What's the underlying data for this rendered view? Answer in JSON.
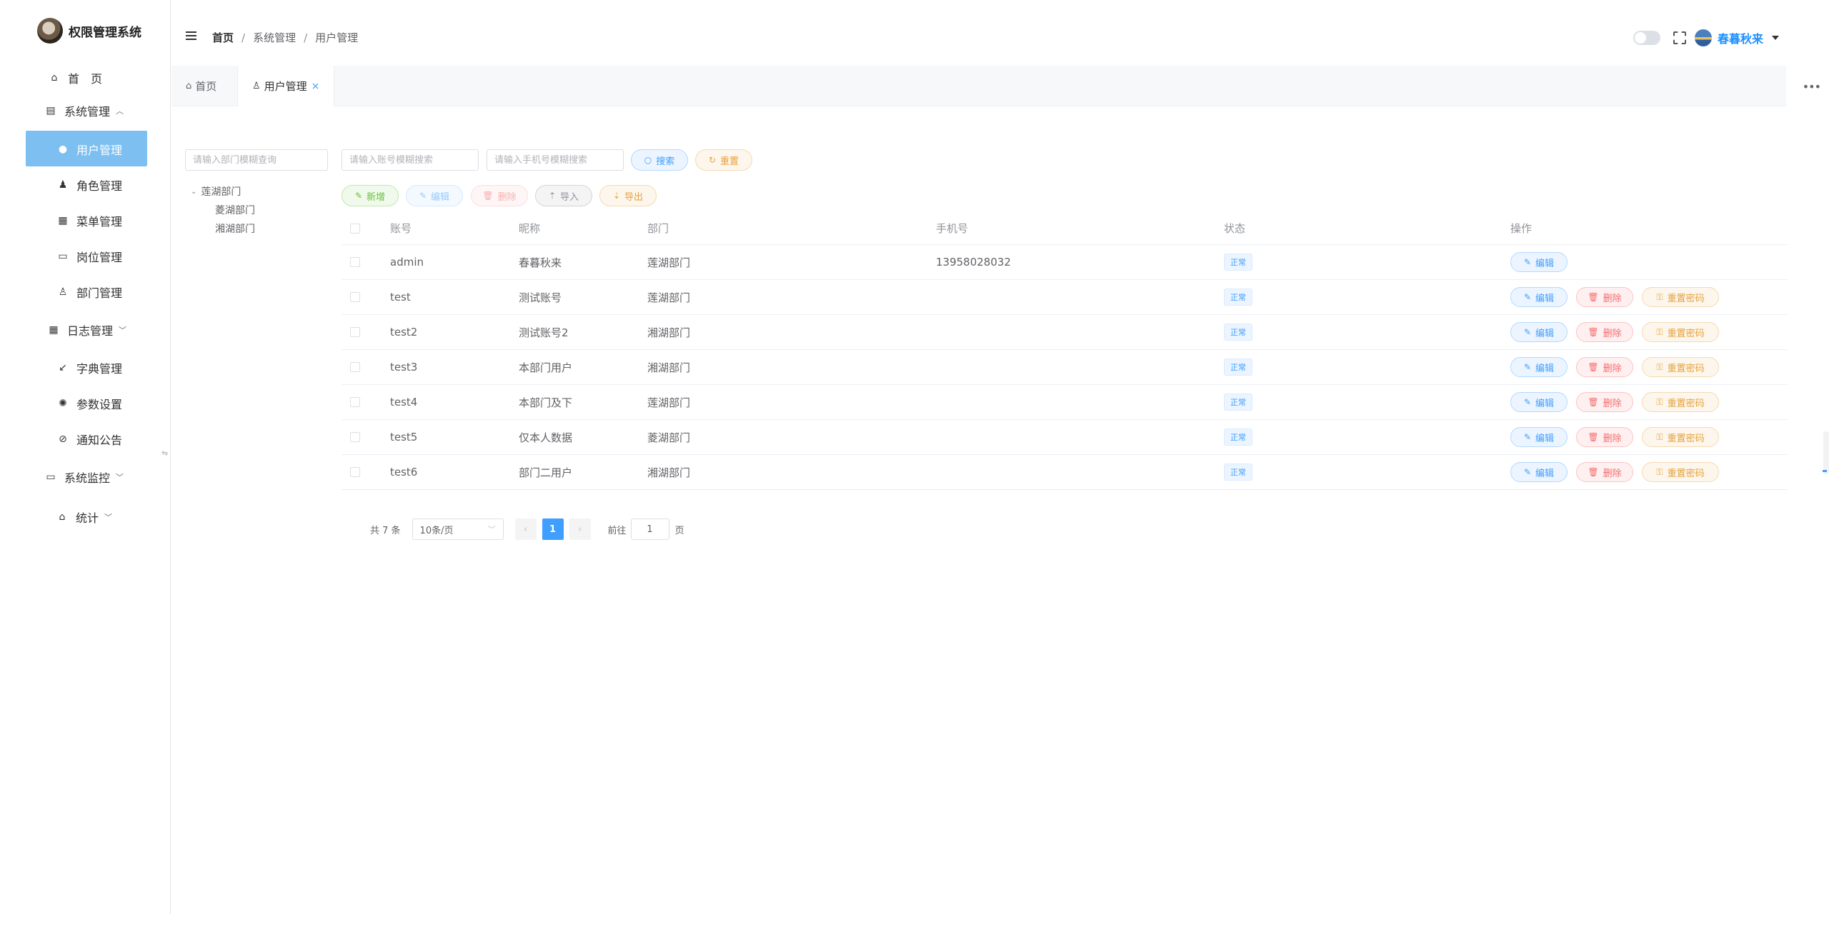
{
  "app": {
    "title": "权限管理系统"
  },
  "sidebar": {
    "items": [
      {
        "label": "首　页",
        "icon": "home-icon"
      },
      {
        "label": "系统管理",
        "icon": "system-icon",
        "chevron": "^"
      },
      {
        "label": "用户管理",
        "icon": "user-icon",
        "active": true
      },
      {
        "label": "角色管理",
        "icon": "role-icon"
      },
      {
        "label": "菜单管理",
        "icon": "menu-grid-icon"
      },
      {
        "label": "岗位管理",
        "icon": "post-icon"
      },
      {
        "label": "部门管理",
        "icon": "dept-icon"
      },
      {
        "label": "日志管理",
        "icon": "calendar-icon",
        "chevron": "⌄"
      },
      {
        "label": "字典管理",
        "icon": "dict-icon"
      },
      {
        "label": "参数设置",
        "icon": "settings-icon"
      },
      {
        "label": "通知公告",
        "icon": "notice-icon"
      },
      {
        "label": "系统监控",
        "icon": "monitor-icon",
        "chevron": "⌄"
      },
      {
        "label": "统计",
        "icon": "stats-icon",
        "chevron": "⌄"
      }
    ]
  },
  "header": {
    "breadcrumb": [
      "首页",
      "系统管理",
      "用户管理"
    ],
    "user_name": "春暮秋来"
  },
  "tabs": [
    {
      "label": "首页"
    },
    {
      "label": "用户管理",
      "close": "×"
    }
  ],
  "dept_panel": {
    "search_placeholder": "请输入部门模糊查询",
    "tree": {
      "root": "莲湖部门",
      "children": [
        "菱湖部门",
        "湘湖部门"
      ]
    }
  },
  "filters": {
    "account_placeholder": "请输入账号模糊搜索",
    "phone_placeholder": "请输入手机号模糊搜索",
    "search_label": "搜索",
    "reset_label": "重置"
  },
  "toolbar": {
    "add": "新增",
    "edit": "编辑",
    "delete": "删除",
    "import": "导入",
    "export": "导出"
  },
  "table": {
    "columns": [
      "账号",
      "昵称",
      "部门",
      "手机号",
      "状态",
      "操作"
    ],
    "rows": [
      {
        "account": "admin",
        "nickname": "春暮秋来",
        "dept": "莲湖部门",
        "phone": "13958028032",
        "status": "正常"
      },
      {
        "account": "test",
        "nickname": "测试账号",
        "dept": "莲湖部门",
        "phone": "",
        "status": "正常"
      },
      {
        "account": "test2",
        "nickname": "测试账号2",
        "dept": "湘湖部门",
        "phone": "",
        "status": "正常"
      },
      {
        "account": "test3",
        "nickname": "本部门用户",
        "dept": "湘湖部门",
        "phone": "",
        "status": "正常"
      },
      {
        "account": "test4",
        "nickname": "本部门及下",
        "dept": "莲湖部门",
        "phone": "",
        "status": "正常"
      },
      {
        "account": "test5",
        "nickname": "仅本人数据",
        "dept": "菱湖部门",
        "phone": "",
        "status": "正常"
      },
      {
        "account": "test6",
        "nickname": "部门二用户",
        "dept": "湘湖部门",
        "phone": "",
        "status": "正常"
      }
    ],
    "actions": {
      "edit": "编辑",
      "delete": "删除",
      "reset_password": "重置密码"
    }
  },
  "pagination": {
    "total": "共 7 条",
    "page_size": "10条/页",
    "current_page": "1",
    "goto_label": "前往",
    "goto_value": "1",
    "page_suffix": "页"
  },
  "colors": {
    "primary": "#409eff",
    "menu_active_bg": "#7cbff0",
    "success": "#67c23a",
    "danger": "#f56c6c",
    "warning": "#e6a23c"
  }
}
